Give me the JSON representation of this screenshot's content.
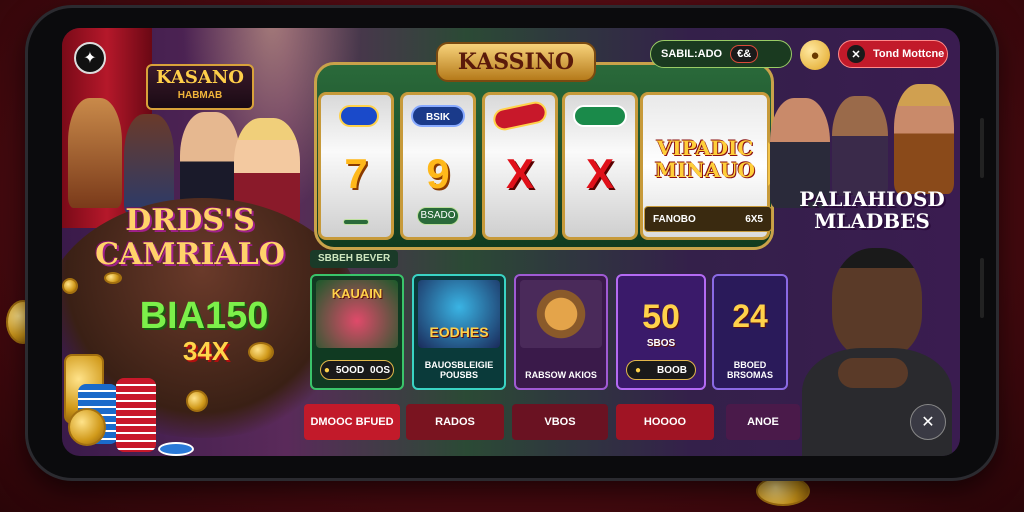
{
  "header": {
    "slot_brand": "KASSINO",
    "balance_label": "SABIL:ADO",
    "balance_pill": "€&",
    "coin_icon": "coin-icon",
    "vip_label": "Tond Mottcne"
  },
  "left_panel": {
    "brand_title": "KASANO",
    "brand_sub": "HABMAB",
    "title_line1": "DRDS'S",
    "title_line2": "CAMRIALO",
    "bonus_big": "BIA150",
    "bonus_small": "34X"
  },
  "slot": {
    "reels": [
      {
        "tag": "",
        "symbol": "7",
        "footer": ""
      },
      {
        "tag": "BSIK",
        "symbol": "9",
        "footer": "BSADO"
      },
      {
        "tag": "",
        "symbol": "X",
        "footer": ""
      },
      {
        "tag": "",
        "symbol": "X",
        "footer": ""
      }
    ],
    "jackpot_title": "VIPADIC MINAUO",
    "jackpot_left": "FANOBO",
    "jackpot_right": "6X5"
  },
  "right_panel": {
    "title": "PALIAHIOSD MLADBES"
  },
  "games": {
    "section_label": "SBBEH BEVER",
    "cards": [
      {
        "name": "KAUAIN",
        "pill_left": "5OOD",
        "pill_right": "0OS",
        "sub": ""
      },
      {
        "name": "EODHES",
        "pill_left": "",
        "pill_right": "",
        "sub": "BAUOSBLEIGIE POUSBS"
      },
      {
        "name": "",
        "pill_left": "",
        "pill_right": "",
        "sub": "RABSOW AKIOS"
      },
      {
        "name": "50",
        "tagline": "SBOS",
        "pill_left": "BOOB",
        "pill_right": "",
        "sub": ""
      },
      {
        "name": "24",
        "pill_left": "",
        "pill_right": "",
        "sub": "BBOED BRSOMAS"
      }
    ]
  },
  "bottom_bar": {
    "buttons": [
      "DMOOC BFUED",
      "RADOS",
      "VBOS",
      "HOOOO",
      "ANOE"
    ]
  },
  "colors": {
    "accent_gold": "#f2c34a",
    "accent_red": "#c21a2a",
    "slot_green": "#2a6a3a"
  }
}
